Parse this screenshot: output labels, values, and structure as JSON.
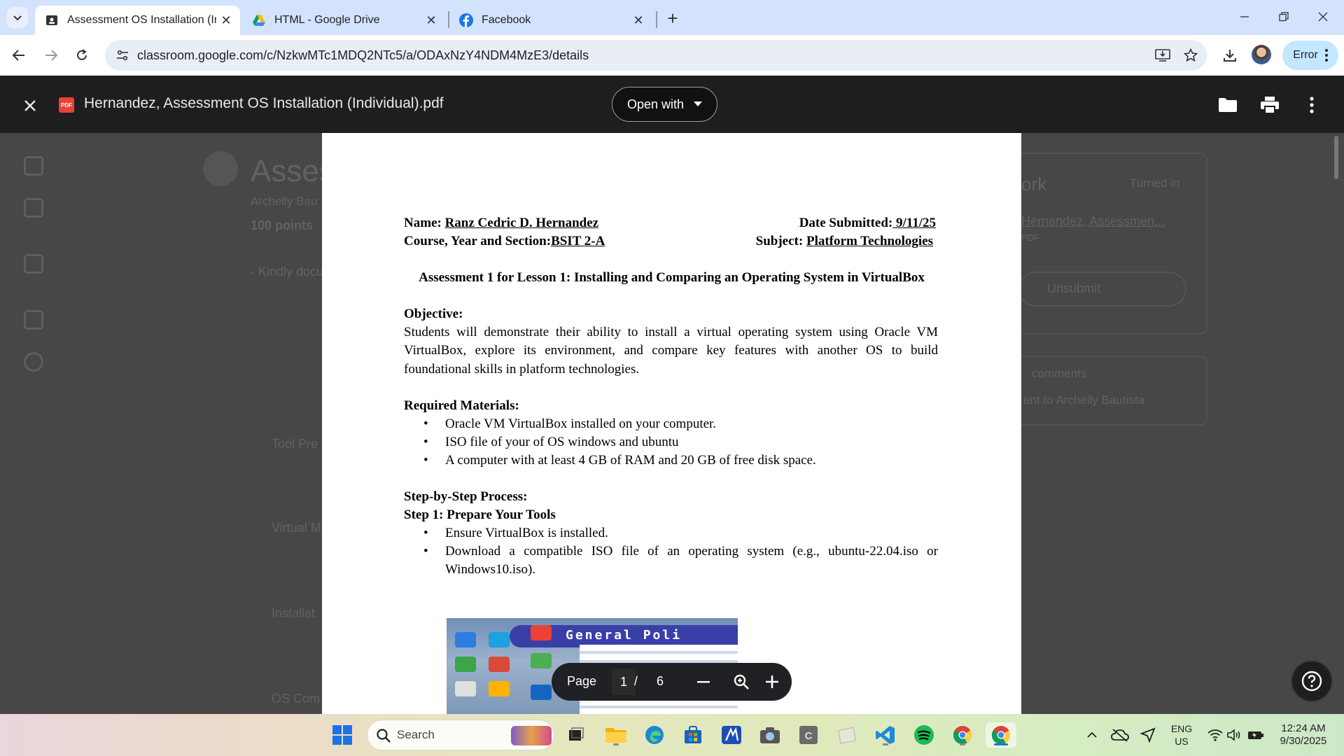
{
  "browser": {
    "tabs": [
      {
        "title": "Assessment OS Installation (Ind",
        "icon": "classroom-icon",
        "active": true
      },
      {
        "title": "HTML - Google Drive",
        "icon": "google-drive-icon",
        "active": false
      },
      {
        "title": "Facebook",
        "icon": "facebook-icon",
        "active": false
      }
    ],
    "url": "classroom.google.com/c/NzkwMTc1MDQ2NTc5/a/ODAxNzY4NDM4MzE3/details",
    "profile_button_label": "Error"
  },
  "background": {
    "title_fragment": "Asses",
    "author_fragment": "Archelly Bau",
    "points": "100 points",
    "instructions_fragment": "- Kindly docu",
    "sections": [
      "Tool Pre",
      "Virtual M",
      "Installat",
      "OS Com"
    ],
    "work_title_fragment": "ork",
    "turned_in": "Turned in",
    "attachment_fragment": "Hernandez, Assessmen...",
    "attachment_type": "PDF",
    "unsubmit": "Unsubmit",
    "comments_fragment": "comments",
    "add_comment_fragment": "ent to Archelly Bautista"
  },
  "viewer": {
    "file_title": "Hernandez, Assessment OS Installation (Individual).pdf",
    "pdf_badge": "PDF",
    "open_with_label": "Open with"
  },
  "document": {
    "name_label": "Name:",
    "name_value": "Ranz Cedric D. Hernandez",
    "date_label": "Date Submitted:",
    "date_value": " 9/11/25",
    "course_label": "Course, Year and Section:",
    "course_value": "BSIT 2-A",
    "subject_label": "Subject:",
    "subject_value": "Platform Technologies",
    "heading": "Assessment 1 for Lesson 1: Installing and Comparing an Operating System in VirtualBox",
    "objective_label": "Objective:",
    "objective_text": "Students will demonstrate their ability to install a virtual operating system using Oracle VM VirtualBox, explore its environment, and compare key features with another OS to build foundational skills in platform technologies.",
    "materials_label": "Required Materials:",
    "materials": [
      "Oracle VM VirtualBox installed on your computer.",
      "ISO file of your of OS windows and ubuntu",
      "A computer with at least 4 GB of RAM and 20 GB of free disk space."
    ],
    "process_label": "Step-by-Step Process:",
    "step1_label": "Step 1: Prepare Your Tools",
    "step1_items": [
      "Ensure VirtualBox is installed.",
      "Download a compatible ISO file of an operating system (e.g., ubuntu-22.04.iso or Windows10.iso)."
    ],
    "screenshot_heading": "General Poli"
  },
  "page_controls": {
    "label": "Page",
    "current": "1",
    "separator": "/",
    "total": "6"
  },
  "taskbar": {
    "search_label": "Search",
    "language": "ENG",
    "region": "US",
    "time": "12:24 AM",
    "date": "9/30/2025"
  },
  "colors": {
    "tabstrip": "#d3e3fd",
    "viewer_header": "#1e1e1e",
    "pdf_red": "#e94235",
    "profile_button": "#c2e7ff"
  }
}
